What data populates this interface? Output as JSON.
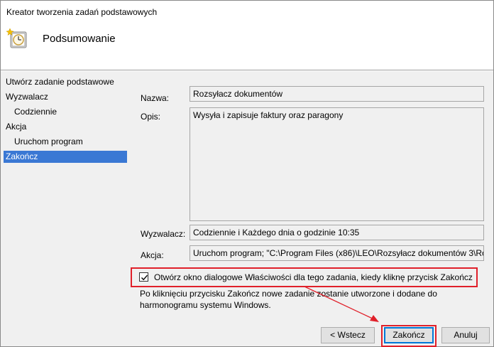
{
  "window": {
    "title": "Kreator tworzenia zadań podstawowych"
  },
  "header": {
    "heading": "Podsumowanie",
    "icon": "clock-star-icon"
  },
  "nav": {
    "items": [
      {
        "label": "Utwórz zadanie podstawowe",
        "active": false
      },
      {
        "label": "Wyzwalacz",
        "active": false
      },
      {
        "label": "Codziennie",
        "active": false
      },
      {
        "label": "Akcja",
        "active": false
      },
      {
        "label": "Uruchom program",
        "active": false
      },
      {
        "label": "Zakończ",
        "active": true
      }
    ]
  },
  "summary": {
    "name_label": "Nazwa:",
    "name_value": "Rozsyłacz dokumentów",
    "desc_label": "Opis:",
    "desc_value": "Wysyła i zapisuje faktury oraz paragony",
    "trigger_label": "Wyzwalacz:",
    "trigger_value": "Codziennie i Każdego dnia o godzinie 10:35",
    "action_label": "Akcja:",
    "action_value": "Uruchom program; \"C:\\Program Files (x86)\\LEO\\Rozsyłacz dokumentów 3\\Ro"
  },
  "option": {
    "checked": true,
    "label": "Otwórz okno dialogowe Właściwości dla tego zadania, kiedy kliknę przycisk Zakończ"
  },
  "info": {
    "text": "Po kliknięciu przycisku Zakończ nowe zadanie zostanie utworzone i dodane do harmonogramu systemu Windows."
  },
  "buttons": {
    "back": "< Wstecz",
    "finish": "Zakończ",
    "cancel": "Anuluj"
  },
  "colors": {
    "highlight_red": "#e0202a",
    "selection_blue": "#3a78d4",
    "primary_border": "#0078d7"
  }
}
